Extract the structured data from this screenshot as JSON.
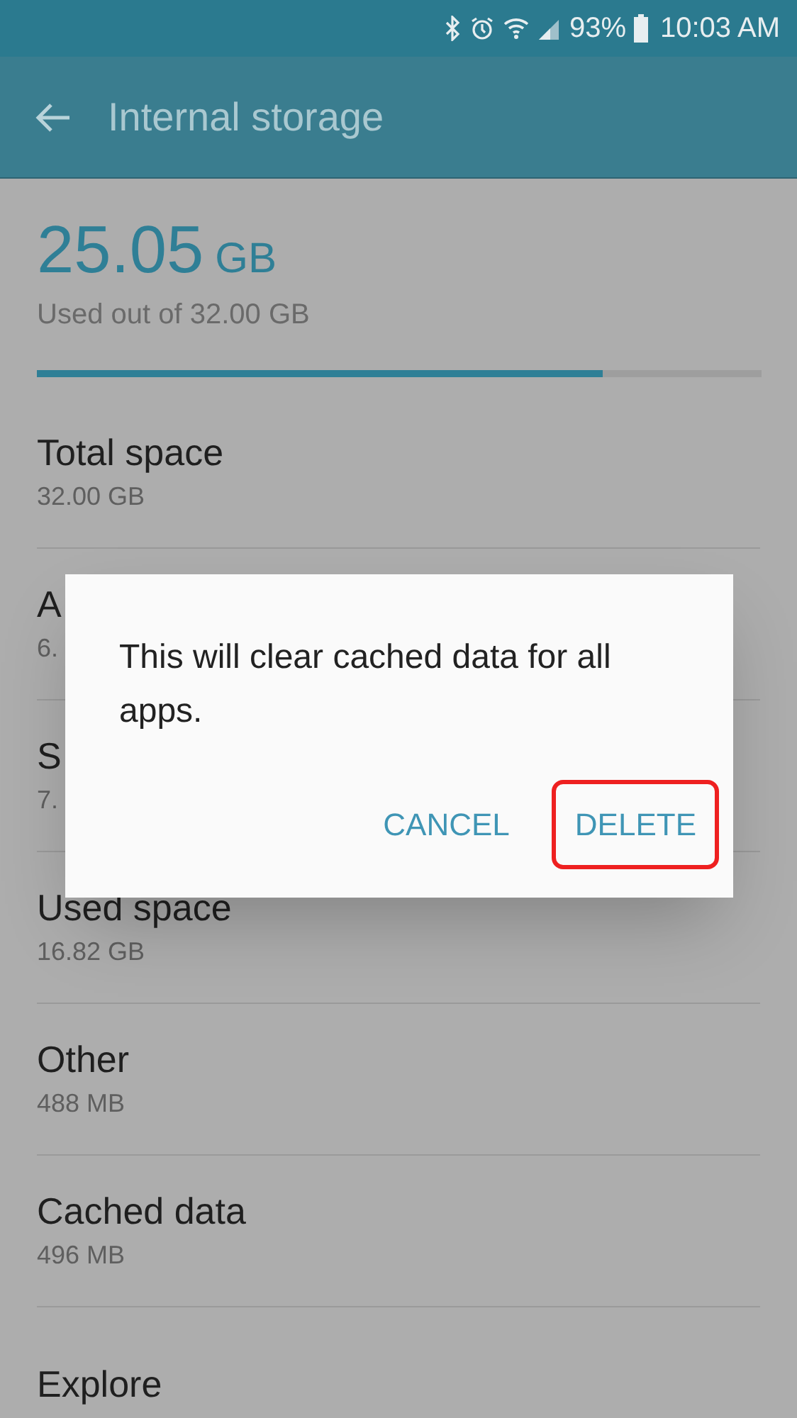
{
  "status_bar": {
    "battery": "93%",
    "time": "10:03 AM"
  },
  "header": {
    "title": "Internal storage"
  },
  "usage": {
    "amount": "25.05",
    "unit": "GB",
    "caption": "Used out of 32.00 GB",
    "level": 0.78
  },
  "rows": [
    {
      "title": "Total space",
      "value": "32.00 GB"
    },
    {
      "title": "A",
      "value": "6."
    },
    {
      "title": "S",
      "value": "7."
    },
    {
      "title": "Used space",
      "value": "16.82 GB"
    },
    {
      "title": "Other",
      "value": "488 MB"
    },
    {
      "title": "Cached data",
      "value": "496 MB"
    },
    {
      "title": "Explore"
    }
  ],
  "dialog": {
    "message": "This will clear cached data for all apps.",
    "buttons": [
      {
        "label": "CANCEL",
        "highlighted": false
      },
      {
        "label": "DELETE",
        "highlighted": true
      }
    ]
  }
}
